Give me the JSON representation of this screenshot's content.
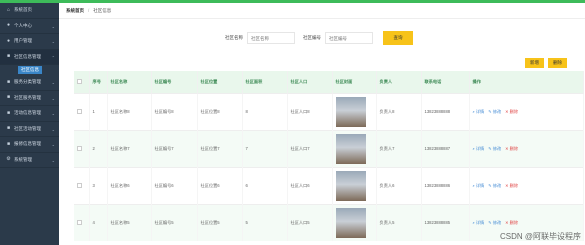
{
  "sidebar": {
    "items": [
      {
        "label": "系统首页",
        "icon": "home-icon"
      },
      {
        "label": "个人中心",
        "icon": "person-icon"
      },
      {
        "label": "用户管理",
        "icon": "user-icon"
      },
      {
        "label": "社区信息管理",
        "icon": "community-icon"
      },
      {
        "label": "服务分类管理",
        "icon": "category-icon"
      },
      {
        "label": "社区服务管理",
        "icon": "service-icon"
      },
      {
        "label": "活动信息管理",
        "icon": "activity-icon"
      },
      {
        "label": "社区活动管理",
        "icon": "event-icon"
      },
      {
        "label": "报修信息管理",
        "icon": "repair-icon"
      },
      {
        "label": "系统管理",
        "icon": "settings-icon"
      }
    ],
    "sub_active": "社区信息"
  },
  "breadcrumb": {
    "home": "系统首页",
    "current": "社区信息"
  },
  "search": {
    "name_label": "社区名称",
    "name_placeholder": "社区名称",
    "id_label": "社区编号",
    "id_placeholder": "社区编号",
    "query_label": "查询"
  },
  "toolbar": {
    "add_label": "新增",
    "delete_label": "删除"
  },
  "table": {
    "headers": [
      "序号",
      "社区名称",
      "社区编号",
      "社区位置",
      "社区面积",
      "社区人口",
      "社区封面",
      "负责人",
      "联系电话",
      "操作"
    ],
    "rows": [
      {
        "idx": "1",
        "name": "社区名称8",
        "code": "社区编号8",
        "loc": "社区位置8",
        "area": "8",
        "pop": "社区人口8",
        "leader": "负责人8",
        "phone": "13823888888"
      },
      {
        "idx": "2",
        "name": "社区名称7",
        "code": "社区编号7",
        "loc": "社区位置7",
        "area": "7",
        "pop": "社区人口7",
        "leader": "负责人7",
        "phone": "13823888887"
      },
      {
        "idx": "3",
        "name": "社区名称6",
        "code": "社区编号6",
        "loc": "社区位置6",
        "area": "6",
        "pop": "社区人口6",
        "leader": "负责人6",
        "phone": "13823888886"
      },
      {
        "idx": "4",
        "name": "社区名称5",
        "code": "社区编号5",
        "loc": "社区位置5",
        "area": "5",
        "pop": "社区人口5",
        "leader": "负责人5",
        "phone": "13823888885"
      }
    ],
    "ops": {
      "detail": "详情",
      "edit": "修改",
      "del": "删除"
    }
  },
  "watermark": "CSDN @阿联毕设程序"
}
